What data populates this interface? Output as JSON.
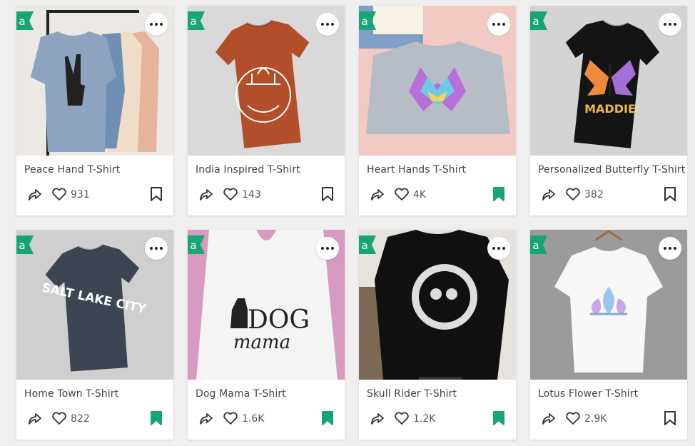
{
  "colors": {
    "accent": "#17a673",
    "save_active": "#17a673",
    "save_inactive": "#333333"
  },
  "cards": [
    {
      "title": "Peace Hand T-Shirt",
      "likes": "931",
      "saved": false,
      "bg": "#ece8e4",
      "shirt": "#8da4c0",
      "art": "peace-hand"
    },
    {
      "title": "India Inspired T-Shirt",
      "likes": "143",
      "saved": false,
      "bg": "#d9d9d9",
      "shirt": "#b24f2a",
      "art": "india-line-art"
    },
    {
      "title": "Heart Hands T-Shirt",
      "likes": "4K",
      "saved": true,
      "bg": "#f3c9c4",
      "shirt": "#b7bdc6",
      "art": "rainbow-heart-hands"
    },
    {
      "title": "Personalized Butterfly T-Shirt",
      "likes": "382",
      "saved": false,
      "bg": "#d4d4d4",
      "shirt": "#141414",
      "art": "butterfly",
      "art_text": "MADDIE"
    },
    {
      "title": "Home Town T-Shirt",
      "likes": "822",
      "saved": true,
      "bg": "#cfcfcf",
      "shirt": "#3e4552",
      "art": "text",
      "art_text": "SALT LAKE CITY"
    },
    {
      "title": "Dog Mama T-Shirt",
      "likes": "1.6K",
      "saved": true,
      "bg": "#d89ac0",
      "shirt": "#f4f4f4",
      "art": "dog-mama",
      "art_text": "DOG",
      "art_text2": "mama"
    },
    {
      "title": "Skull Rider T-Shirt",
      "likes": "1.2K",
      "saved": true,
      "bg": "#e6e3df",
      "shirt": "#101010",
      "art": "skull"
    },
    {
      "title": "Lotus Flower T-Shirt",
      "likes": "2.9K",
      "saved": false,
      "bg": "#9b9b9b",
      "shirt": "#f7f7f7",
      "art": "lotus"
    }
  ]
}
